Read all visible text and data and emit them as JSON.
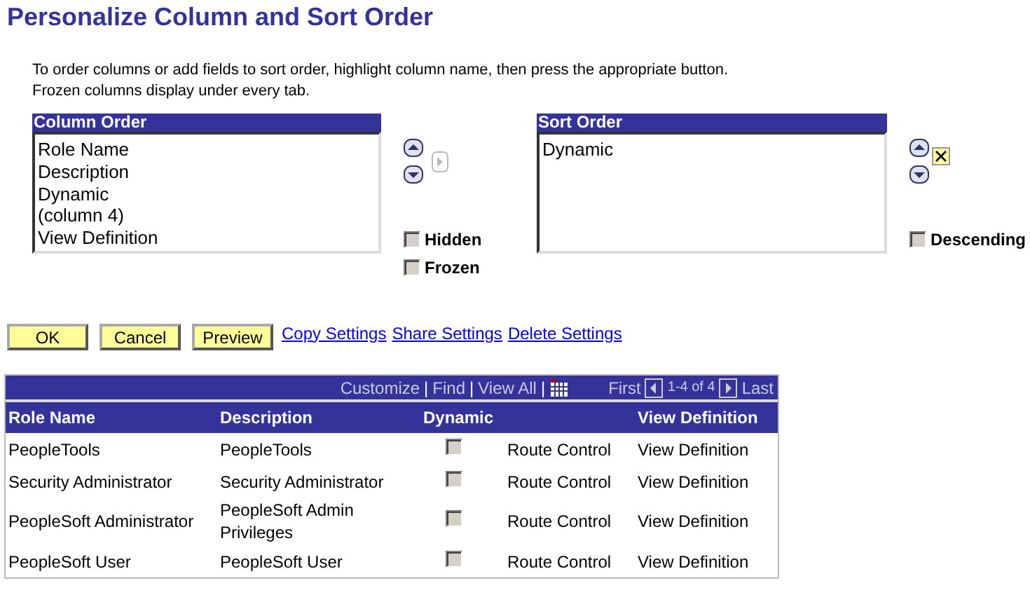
{
  "page": {
    "title": "Personalize Column and Sort Order"
  },
  "instructions": [
    "To order columns or add fields to sort order, highlight column name, then press the appropriate button.",
    "Frozen columns display under every tab."
  ],
  "column_order": {
    "title": "Column Order",
    "items": [
      "Role Name",
      "Description",
      "Dynamic",
      "(column 4)",
      "View Definition"
    ],
    "options": [
      {
        "label": "Hidden",
        "checked": false
      },
      {
        "label": "Frozen",
        "checked": false
      }
    ]
  },
  "sort_order": {
    "title": "Sort Order",
    "items": [
      "Dynamic"
    ],
    "options": [
      {
        "label": "Descending",
        "checked": false
      }
    ]
  },
  "buttons": [
    "OK",
    "Cancel",
    "Preview"
  ],
  "links": [
    "Copy Settings",
    "Share Settings",
    "Delete Settings"
  ],
  "grid": {
    "toolbar": [
      {
        "kind": "link",
        "text": "Customize"
      },
      {
        "kind": "sep",
        "text": "|"
      },
      {
        "kind": "link",
        "text": "Find"
      },
      {
        "kind": "sep",
        "text": "|"
      },
      {
        "kind": "link",
        "text": "View All"
      },
      {
        "kind": "sep",
        "text": "|"
      }
    ],
    "pager": {
      "first": "First",
      "range": "1-4 of 4",
      "last": "Last"
    },
    "columns": [
      "Role Name",
      "Description",
      "Dynamic",
      "View Definition"
    ],
    "rows": [
      {
        "role_name": "PeopleTools",
        "description": "PeopleTools",
        "dynamic": false,
        "column_4": "Route Control",
        "view_definition": "View Definition"
      },
      {
        "role_name": "Security Administrator",
        "description": "Security Administrator",
        "dynamic": false,
        "column_4": "Route Control",
        "view_definition": "View Definition"
      },
      {
        "role_name": "PeopleSoft Administrator",
        "description": "PeopleSoft Admin Privileges",
        "dynamic": false,
        "column_4": "Route Control",
        "view_definition": "View Definition"
      },
      {
        "role_name": "PeopleSoft User",
        "description": "PeopleSoft User",
        "dynamic": false,
        "column_4": "Route Control",
        "view_definition": "View Definition"
      }
    ]
  }
}
